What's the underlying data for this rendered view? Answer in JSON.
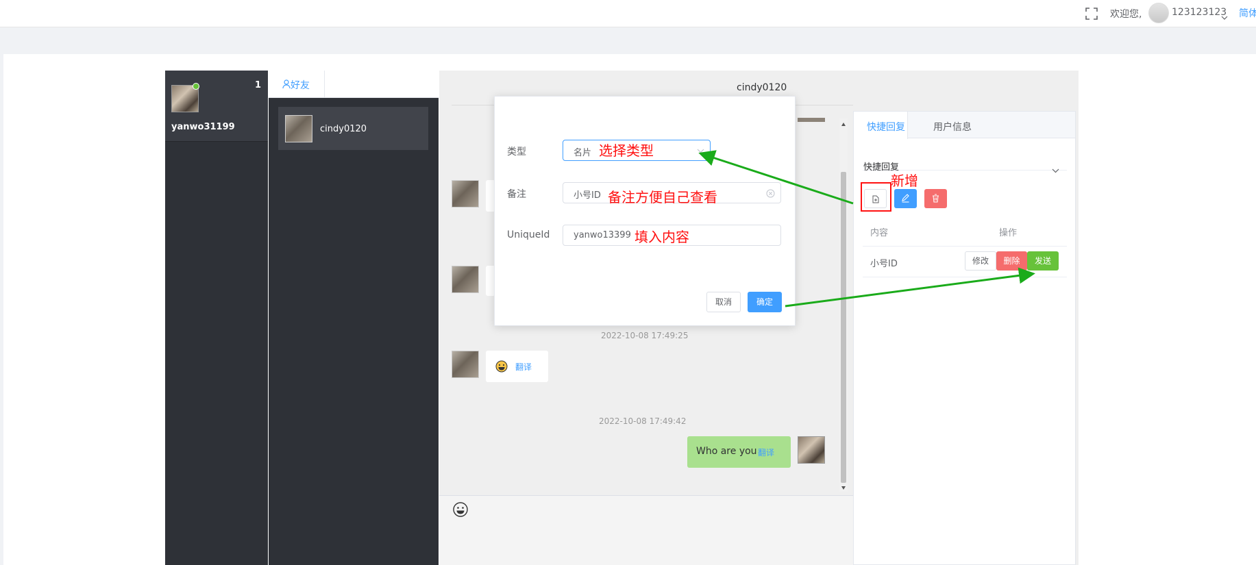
{
  "header": {
    "welcome": "欢迎您,",
    "username": "123123123",
    "language": "简体"
  },
  "account": {
    "name": "yanwo31199",
    "unread": "1"
  },
  "contacts": {
    "tab_label": "好友",
    "items": [
      {
        "name": "cindy0120"
      }
    ]
  },
  "chat": {
    "title": "cindy0120",
    "timestamps": [
      "2022-10-08 17:49:25",
      "2022-10-08 17:49:42"
    ],
    "translate_label": "翻译",
    "outgoing_text": "Who are you"
  },
  "dialog": {
    "type_label": "类型",
    "type_value": "名片",
    "note_label": "备注",
    "note_value": "小号ID",
    "uid_label": "UniqueId",
    "uid_value": "yanwo13399",
    "cancel": "取消",
    "confirm": "确定"
  },
  "side_panel": {
    "tabs": [
      "快捷回复",
      "用户信息"
    ],
    "section_title": "快捷回复",
    "columns": [
      "内容",
      "操作"
    ],
    "rows": [
      {
        "content": "小号ID",
        "edit": "修改",
        "delete": "删除",
        "send": "发送"
      }
    ]
  },
  "annotations": {
    "select_type": "选择类型",
    "note_hint": "备注方便自己查看",
    "fill_content": "填入内容",
    "add_new": "新增"
  },
  "colors": {
    "primary": "#409eff",
    "danger": "#f56c6c",
    "success": "#67c23a",
    "dark_sidebar": "#2e3137",
    "annotation": "#ff1010",
    "arrow": "#1aab1a"
  }
}
